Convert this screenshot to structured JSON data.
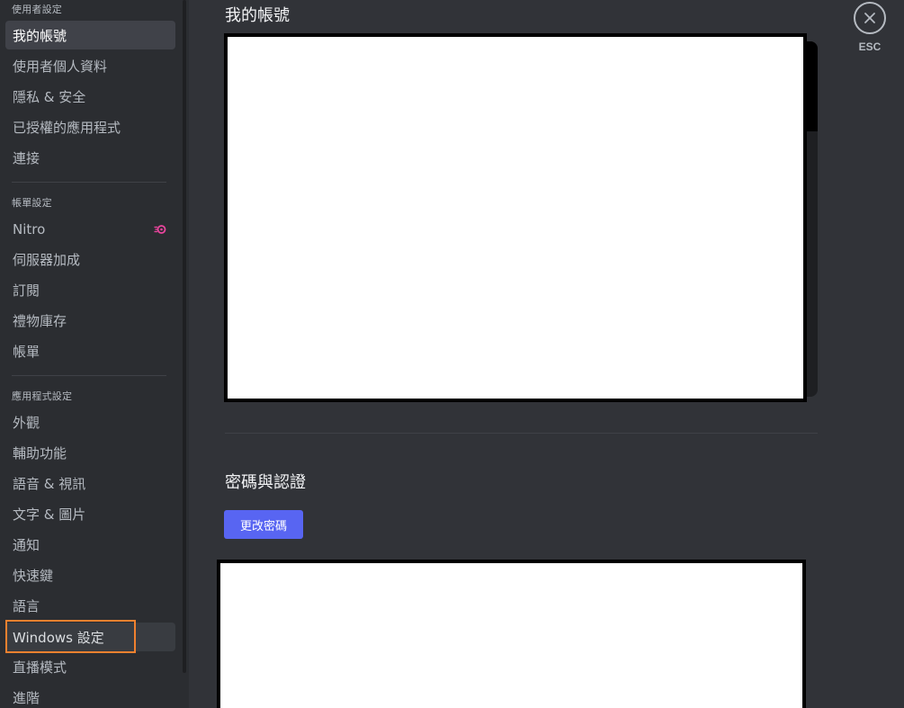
{
  "sidebar": {
    "groups": [
      {
        "header": "使用者設定",
        "items": [
          {
            "label": "我的帳號"
          },
          {
            "label": "使用者個人資料"
          },
          {
            "label": "隱私 & 安全"
          },
          {
            "label": "已授權的應用程式"
          },
          {
            "label": "連接"
          }
        ]
      },
      {
        "header": "帳單設定",
        "items": [
          {
            "label": "Nitro"
          },
          {
            "label": "伺服器加成"
          },
          {
            "label": "訂閱"
          },
          {
            "label": "禮物庫存"
          },
          {
            "label": "帳單"
          }
        ]
      },
      {
        "header": "應用程式設定",
        "items": [
          {
            "label": "外觀"
          },
          {
            "label": "輔助功能"
          },
          {
            "label": "語音 & 視訊"
          },
          {
            "label": "文字 & 圖片"
          },
          {
            "label": "通知"
          },
          {
            "label": "快速鍵"
          },
          {
            "label": "語言"
          },
          {
            "label": "Windows 設定"
          },
          {
            "label": "直播模式"
          },
          {
            "label": "進階"
          }
        ]
      }
    ],
    "selected_item": "我的帳號",
    "hovered_item": "Windows 設定",
    "nitro_icon": "nitro-badge-icon",
    "nitro_color": "#eb459e"
  },
  "main": {
    "page_title": "我的帳號",
    "password_section": {
      "title": "密碼與認證",
      "change_password_label": "更改密碼"
    }
  },
  "close": {
    "icon": "close-icon",
    "label": "ESC"
  },
  "colors": {
    "accent": "#5865f2",
    "highlight": "#f0812f",
    "sidebar_bg": "#2b2d31",
    "main_bg": "#313338"
  }
}
